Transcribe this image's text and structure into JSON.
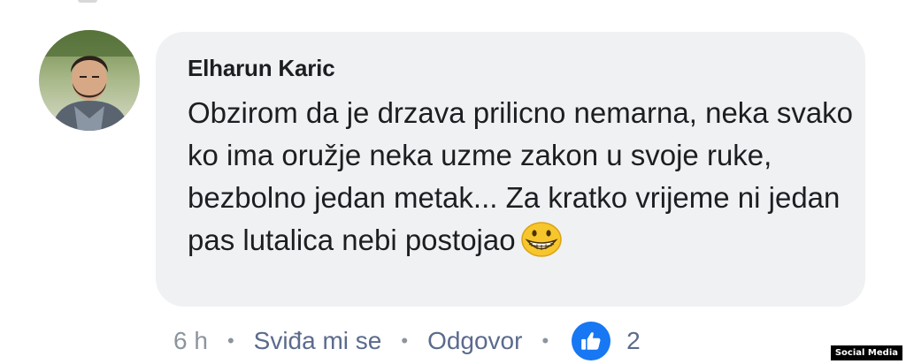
{
  "comment": {
    "author": "Elharun Karic",
    "text": "Obzirom da je drzava prilicno nemarna, neka svako ko ima oružje neka uzme zakon u svoje ruke, bezbolno jedan metak... Za kratko vrijeme ni jedan pas lutalica nebi postojao",
    "emoji": "grinning-face-emoji"
  },
  "meta": {
    "time": "6 h",
    "like_label": "Sviđa mi se",
    "reply_label": "Odgovor",
    "reaction_count": "2",
    "reaction_icon": "thumbs-up-icon",
    "reaction_color": "#1877f2"
  },
  "watermark": "Social Media"
}
